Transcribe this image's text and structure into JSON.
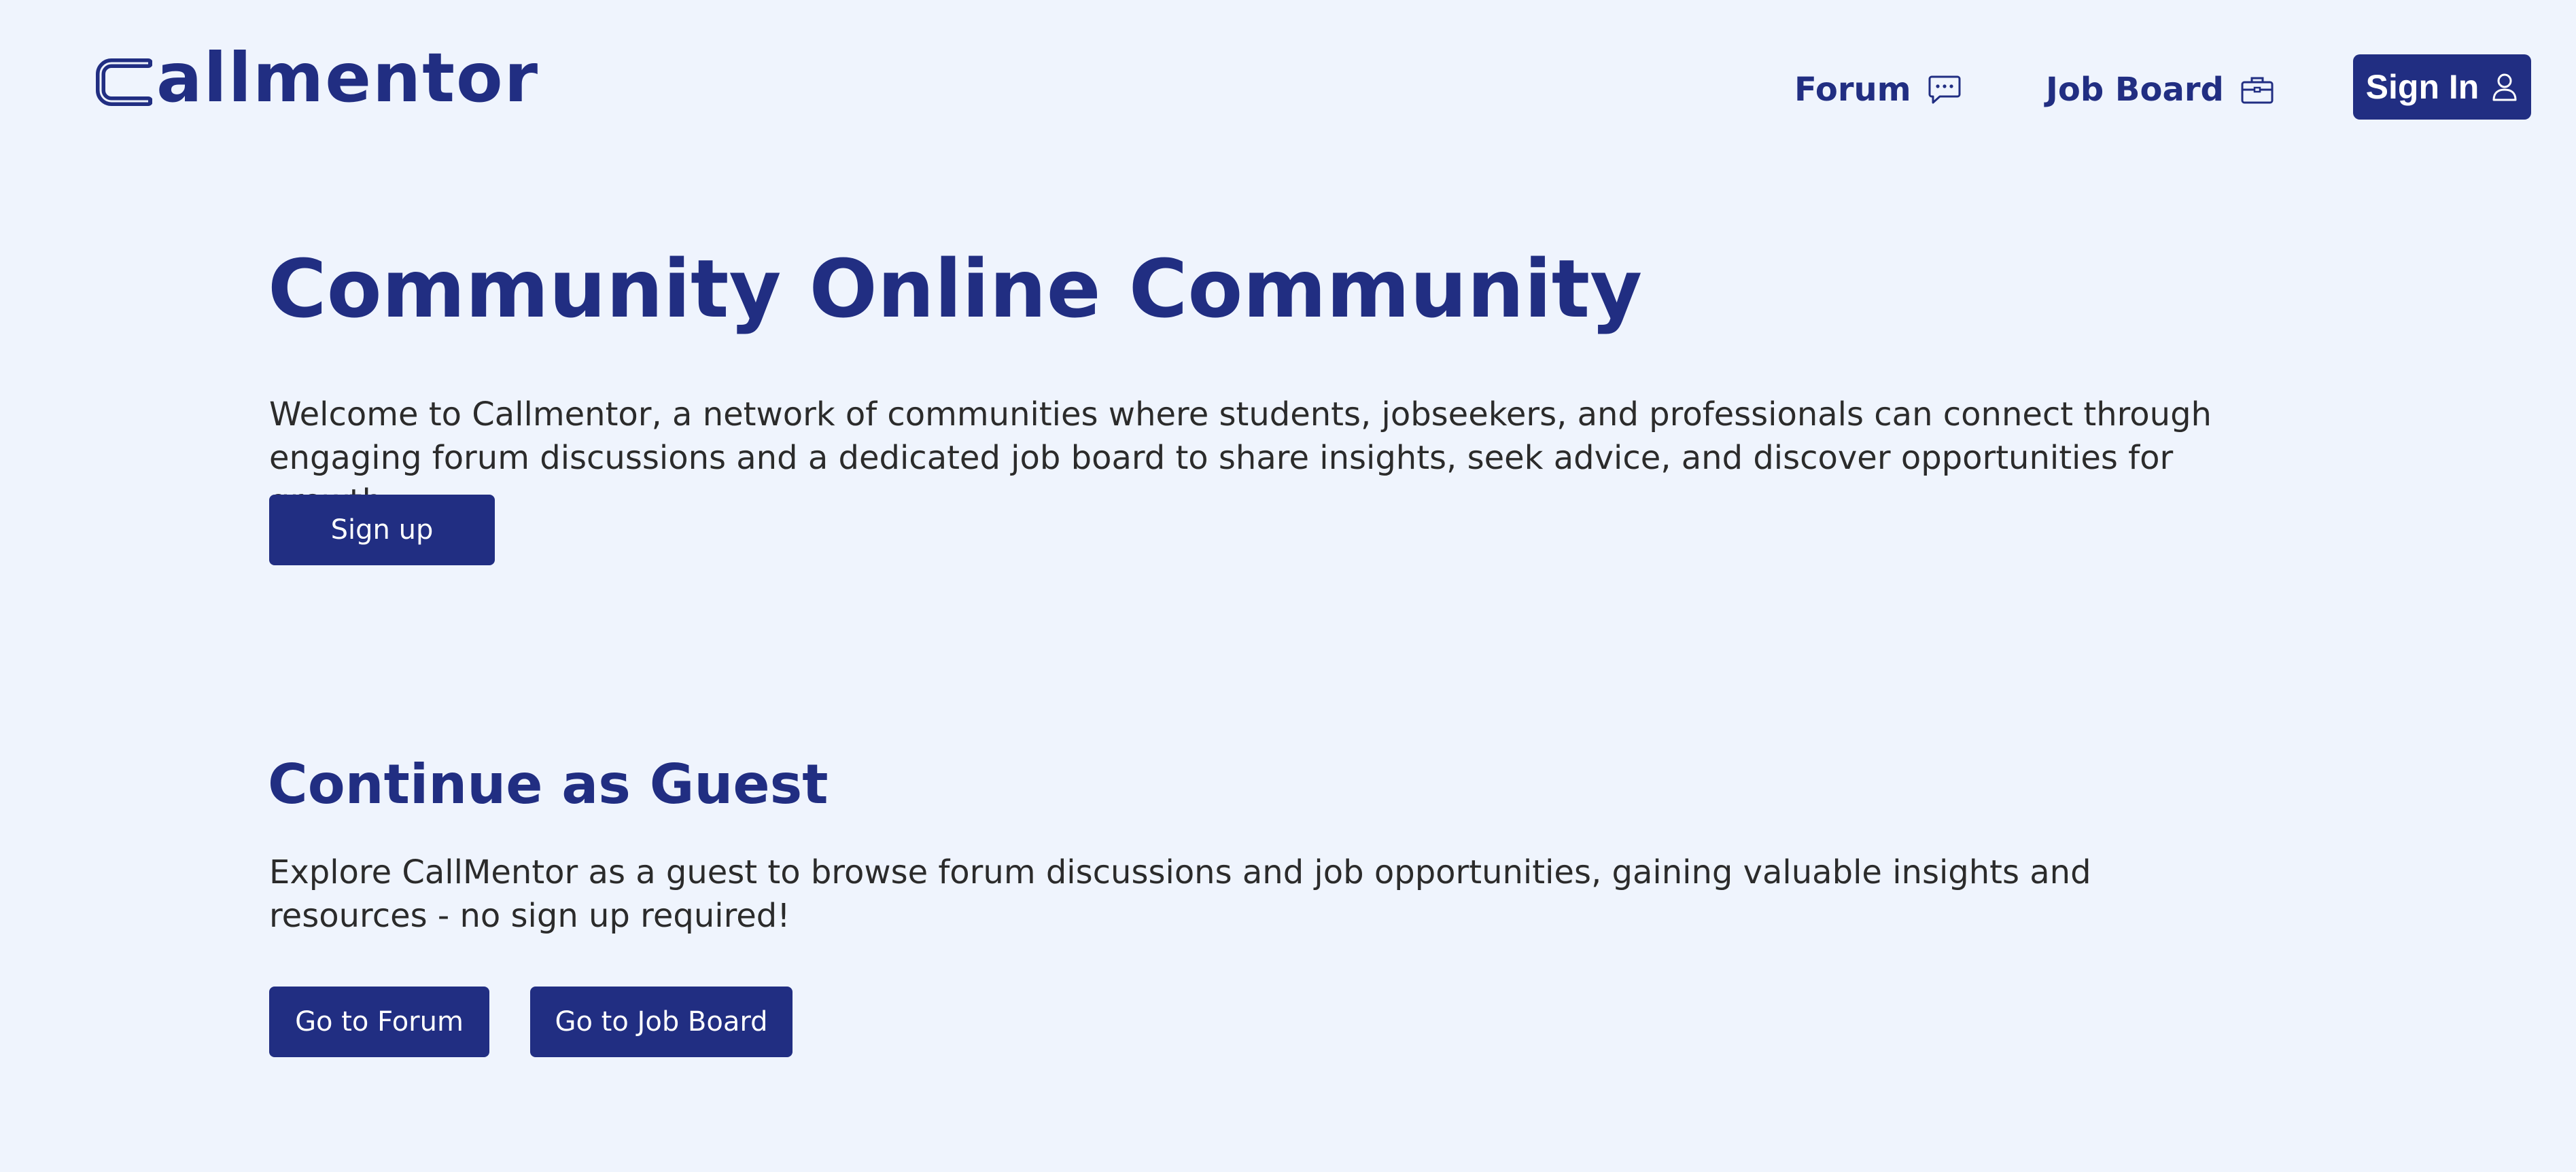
{
  "header": {
    "logo_text": "allmentor",
    "nav": {
      "forum_label": "Forum",
      "job_board_label": "Job Board"
    },
    "sign_in_label": "Sign In",
    "icons": {
      "forum": "chat-bubble-icon",
      "job_board": "briefcase-icon",
      "sign_in": "user-icon"
    }
  },
  "hero": {
    "title": "Community Online Community",
    "description": "Welcome to Callmentor, a network of communities where students, jobseekers, and professionals can connect through engaging forum discussions and a dedicated job board to share insights, seek advice, and discover opportunities for growth.",
    "signup_label": "Sign up"
  },
  "guest": {
    "title": "Continue as Guest",
    "description": "Explore CallMentor as a guest to browse forum discussions and job opportunities, gaining valuable insights and resources - no sign up required!",
    "forum_button_label": "Go to Forum",
    "job_board_button_label": "Go to Job Board"
  },
  "colors": {
    "background": "#eff4fd",
    "brand": "#212e82",
    "text": "#2b2b2b",
    "button_text": "#ffffff"
  }
}
